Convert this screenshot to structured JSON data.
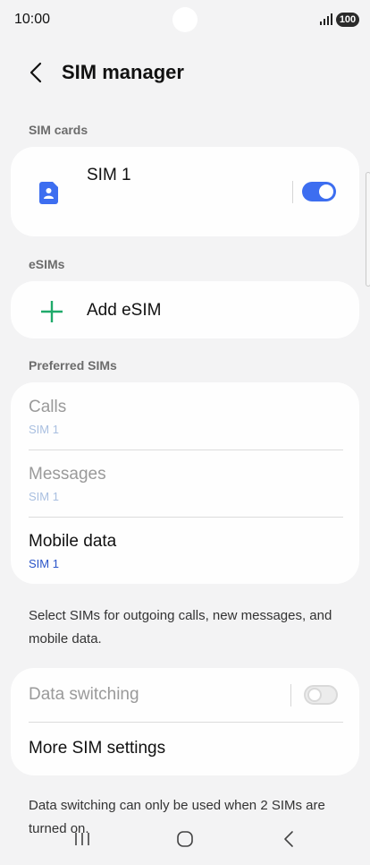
{
  "status_bar": {
    "time": "10:00",
    "battery": "100",
    "signal_icon": "signal-bars-icon"
  },
  "header": {
    "title": "SIM manager",
    "back_icon": "back-arrow-icon"
  },
  "sim_cards": {
    "section_label": "SIM cards",
    "items": [
      {
        "name": "SIM 1",
        "icon": "sim-card-icon",
        "toggle_on": true
      }
    ]
  },
  "esims": {
    "section_label": "eSIMs",
    "add_label": "Add eSIM",
    "add_icon": "plus-icon"
  },
  "preferred_sims": {
    "section_label": "Preferred SIMs",
    "rows": [
      {
        "title": "Calls",
        "value": "SIM 1",
        "enabled": false
      },
      {
        "title": "Messages",
        "value": "SIM 1",
        "enabled": false
      },
      {
        "title": "Mobile data",
        "value": "SIM 1",
        "enabled": true
      }
    ],
    "helper_text": "Select SIMs for outgoing calls, new messages, and mobile data."
  },
  "data_switching": {
    "title": "Data switching",
    "toggle_on": false,
    "enabled": false
  },
  "more_settings": {
    "title": "More SIM settings"
  },
  "footer_text": "Data switching can only be used when 2 SIMs are turned on.",
  "nav_bar": {
    "recents_icon": "recents-icon",
    "home_icon": "home-icon",
    "back_icon": "back-icon"
  },
  "colors": {
    "accent": "#3d6ef0",
    "add_icon": "#1faa6a",
    "background": "#f3f3f4"
  }
}
